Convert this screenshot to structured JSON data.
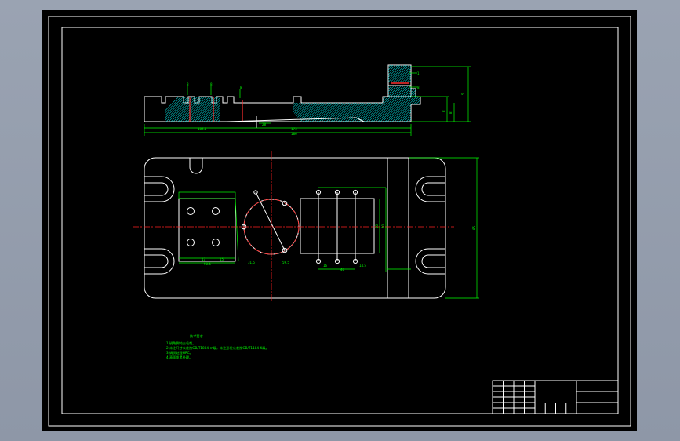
{
  "drawing": {
    "background": "#000000",
    "line_color": "#ffffff",
    "dimension_color": "#00ff00",
    "centerline_color": "#ff2020",
    "hatch_color": "#00c8c8",
    "section_dims": [
      "8",
      "8",
      "8",
      "1",
      "28",
      "5",
      "8",
      "8",
      "8",
      "186.5",
      "173",
      "186"
    ],
    "plan_dims": [
      "17",
      "15",
      "50.5",
      "31.5",
      "59.5",
      "16",
      "14.5",
      "40",
      "40",
      "40",
      "85"
    ],
    "notes_title": "技术要求",
    "notes_lines": [
      "1.锐角倒钝去毛刺。",
      "2.未注尺寸公差按GB/T1804-m级，未注形位公差按GB/T1184-K级。",
      "3.调质处理HRC。",
      "4.表面发黑处理。"
    ],
    "title_block_label": ""
  }
}
